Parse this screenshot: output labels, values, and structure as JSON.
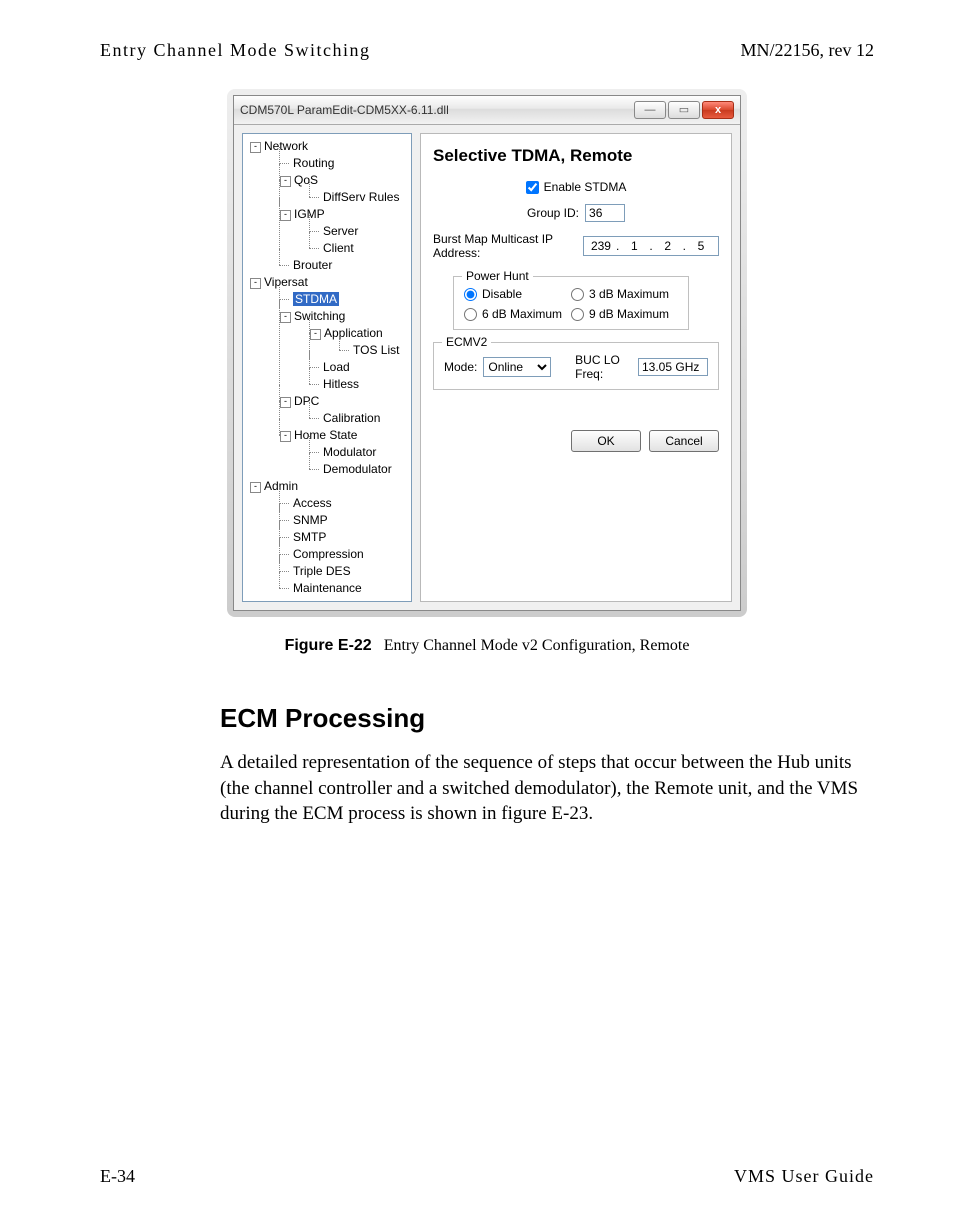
{
  "header": {
    "left": "Entry Channel Mode Switching",
    "right": "MN/22156, rev 12"
  },
  "dialog": {
    "title": "CDM570L ParamEdit-CDM5XX-6.11.dll",
    "tree": {
      "network": "Network",
      "routing": "Routing",
      "qos": "QoS",
      "diffserv": "DiffServ Rules",
      "igmp": "IGMP",
      "server": "Server",
      "client": "Client",
      "brouter": "Brouter",
      "vipersat": "Vipersat",
      "stdma": "STDMA",
      "switching": "Switching",
      "application": "Application",
      "tos": "TOS List",
      "load": "Load",
      "hitless": "Hitless",
      "dpc": "DPC",
      "calibration": "Calibration",
      "home_state": "Home State",
      "modulator": "Modulator",
      "demodulator": "Demodulator",
      "admin": "Admin",
      "access": "Access",
      "snmp": "SNMP",
      "smtp": "SMTP",
      "compression": "Compression",
      "tdes": "Triple DES",
      "maintenance": "Maintenance"
    },
    "pane": {
      "heading": "Selective TDMA, Remote",
      "enable_label": "Enable STDMA",
      "group_label": "Group ID:",
      "group_value": "36",
      "burst_label": "Burst Map Multicast IP Address:",
      "ip": [
        "239",
        "1",
        "2",
        "5"
      ],
      "power_hunt": {
        "title": "Power Hunt",
        "disable": "Disable",
        "db3": "3 dB Maximum",
        "db6": "6 dB Maximum",
        "db9": "9 dB Maximum"
      },
      "ecm": {
        "title": "ECMV2",
        "mode_label": "Mode:",
        "mode_value": "Online",
        "buc_label": "BUC LO Freq:",
        "buc_value": "13.05 GHz"
      },
      "ok": "OK",
      "cancel": "Cancel"
    }
  },
  "figure": {
    "label": "Figure E-22",
    "text": "Entry Channel Mode v2 Configuration, Remote"
  },
  "section": {
    "heading": "ECM Processing",
    "body": "A detailed representation of the sequence of steps that occur between the Hub units (the channel controller and a switched demodulator), the Remote unit, and the VMS during the ECM process is shown in figure E-23."
  },
  "footer": {
    "left": "E-34",
    "right": "VMS User Guide"
  }
}
